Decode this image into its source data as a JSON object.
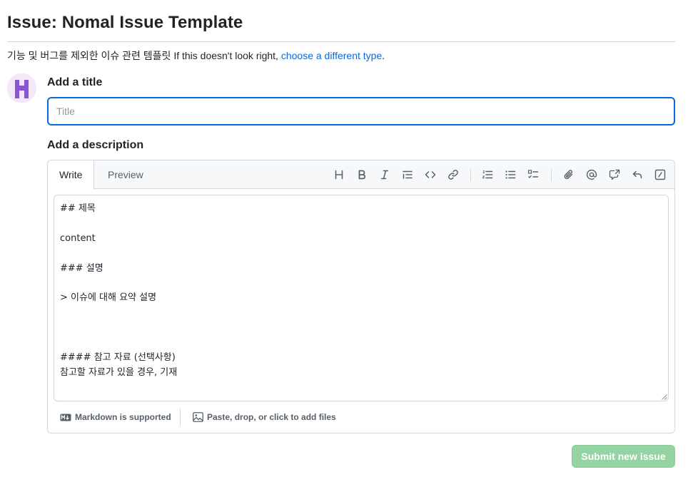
{
  "header": {
    "title": "Issue: Nomal Issue Template",
    "template_description": "기능 및 버그를 제외한 이슈 관련 템플릿",
    "prompt_text": "If this doesn't look right,",
    "change_type_link": "choose a different type",
    "prompt_end": "."
  },
  "form": {
    "title_label": "Add a title",
    "title_placeholder": "Title",
    "title_value": "",
    "description_label": "Add a description"
  },
  "editor": {
    "tabs": [
      {
        "label": "Write",
        "selected": true
      },
      {
        "label": "Preview",
        "selected": false
      }
    ],
    "toolbar": [
      "heading-icon",
      "bold-icon",
      "italic-icon",
      "quote-icon",
      "code-icon",
      "link-icon",
      "numbered-list-icon",
      "bulleted-list-icon",
      "task-list-icon",
      "attach-icon",
      "mention-icon",
      "cross-reference-icon",
      "reply-icon",
      "slash-command-icon"
    ],
    "body": "## 제목\n\ncontent\n\n### 설명\n\n> 이슈에 대해 요약 설명\n\n\n\n#### 참고 자료 (선택사항)\n참고할 자료가 있을 경우, 기재",
    "footer": {
      "markdown_note": "Markdown is supported",
      "attach_note": "Paste, drop, or click to add files"
    }
  },
  "actions": {
    "submit_label": "Submit new issue"
  },
  "colors": {
    "link": "#0969da",
    "focus_border": "#0969da",
    "submit_disabled_bg": "#94d3a2",
    "avatar_purple": "#8a55d2"
  }
}
